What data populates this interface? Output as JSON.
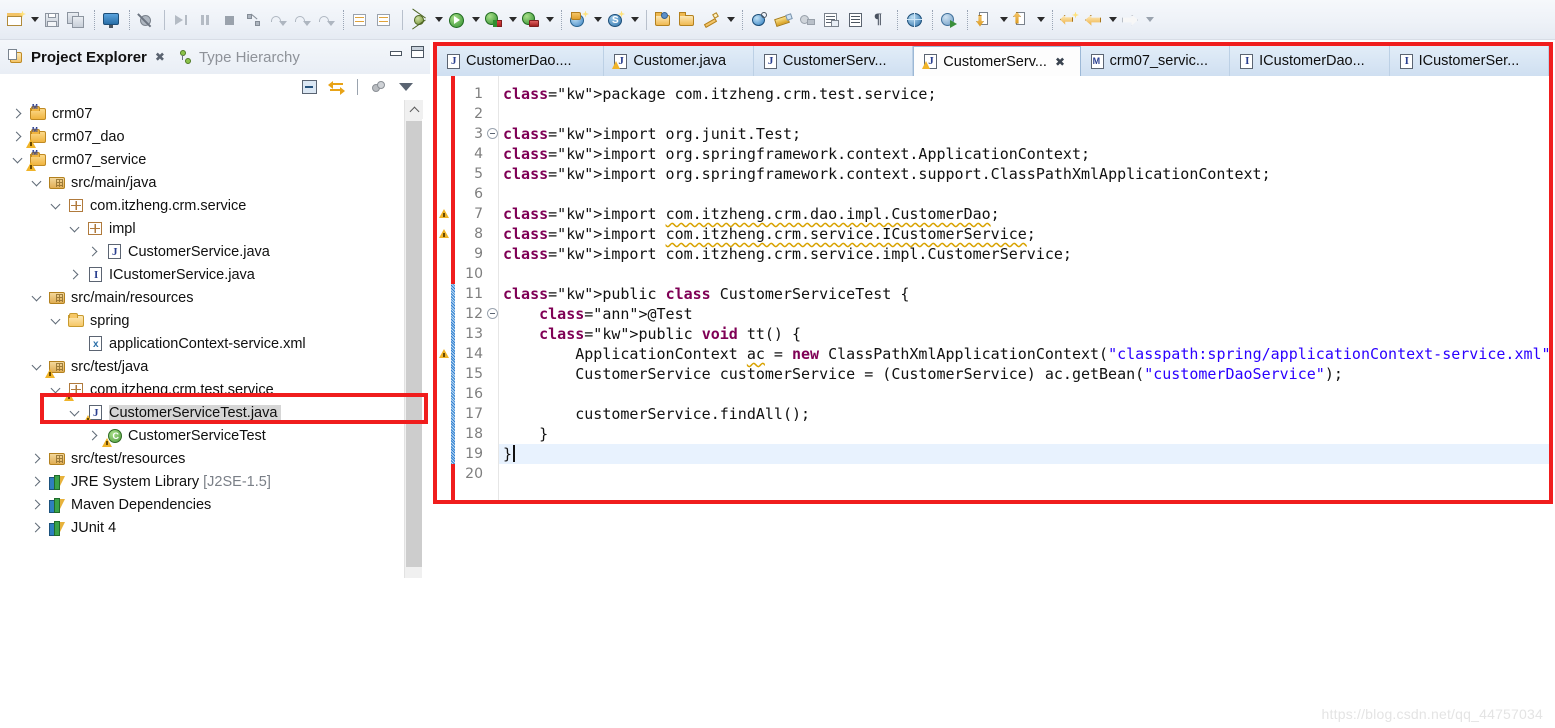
{
  "toolbar": {
    "groups": [
      {
        "name": "file",
        "items": [
          {
            "icon": "new-wizard-icon",
            "dropdown": true
          },
          {
            "icon": "save-icon",
            "dropdown": false
          },
          {
            "icon": "save-all-icon",
            "dropdown": false
          }
        ]
      },
      {
        "name": "console",
        "items": [
          {
            "icon": "open-console-icon",
            "dropdown": false
          }
        ]
      },
      {
        "name": "skip-breakpoints",
        "items": [
          {
            "icon": "skip-all-breakpoints-icon",
            "dropdown": false
          }
        ]
      },
      {
        "name": "debug-controls",
        "items": [
          {
            "icon": "resume-icon",
            "dropdown": false
          },
          {
            "icon": "suspend-icon",
            "dropdown": false
          },
          {
            "icon": "terminate-icon",
            "dropdown": false
          },
          {
            "icon": "disconnect-icon",
            "dropdown": false
          },
          {
            "icon": "step-into-icon",
            "dropdown": false
          },
          {
            "icon": "step-over-icon",
            "dropdown": false
          },
          {
            "icon": "step-return-icon",
            "dropdown": false
          }
        ]
      },
      {
        "name": "coverage",
        "items": [
          {
            "icon": "coverage-session-icon",
            "dropdown": false
          },
          {
            "icon": "coverage-reset-icon",
            "dropdown": false
          }
        ]
      },
      {
        "name": "launch",
        "items": [
          {
            "icon": "debug-bug-icon",
            "dropdown": true
          },
          {
            "icon": "run-icon",
            "dropdown": true
          },
          {
            "icon": "coverage-run-icon",
            "dropdown": true
          },
          {
            "icon": "external-tools-icon",
            "dropdown": true
          }
        ]
      },
      {
        "name": "web",
        "items": [
          {
            "icon": "new-server-icon",
            "dropdown": true
          },
          {
            "icon": "svn-icon",
            "dropdown": true
          }
        ]
      },
      {
        "name": "java",
        "items": [
          {
            "icon": "new-package-icon",
            "dropdown": false
          },
          {
            "icon": "new-class-icon",
            "dropdown": false
          },
          {
            "icon": "new-java-element-icon",
            "dropdown": true
          }
        ]
      },
      {
        "name": "search",
        "items": [
          {
            "icon": "search-icon",
            "dropdown": false
          },
          {
            "icon": "marker-pen-icon",
            "dropdown": false
          },
          {
            "icon": "link-icon",
            "dropdown": false
          },
          {
            "icon": "open-task-icon",
            "dropdown": false
          },
          {
            "icon": "properties-icon",
            "dropdown": false
          },
          {
            "icon": "pilcrow-icon",
            "dropdown": false
          }
        ]
      },
      {
        "name": "browser",
        "items": [
          {
            "icon": "open-browser-icon",
            "dropdown": false
          }
        ]
      },
      {
        "name": "next-annotation",
        "items": [
          {
            "icon": "run-last-tool-icon",
            "dropdown": false
          }
        ]
      },
      {
        "name": "annotations",
        "items": [
          {
            "icon": "next-annotation-icon",
            "dropdown": true
          },
          {
            "icon": "previous-annotation-icon",
            "dropdown": true
          }
        ]
      },
      {
        "name": "navigation",
        "items": [
          {
            "icon": "back-edit-icon",
            "dropdown": false
          },
          {
            "icon": "back-icon",
            "dropdown": true
          },
          {
            "icon": "forward-icon",
            "dropdown": true
          }
        ]
      }
    ]
  },
  "left_panel": {
    "tabs": [
      {
        "label": "Project Explorer",
        "icon": "project-explorer-icon",
        "active": true,
        "closable": true
      },
      {
        "label": "Type Hierarchy",
        "icon": "type-hierarchy-icon",
        "active": false,
        "closable": false
      }
    ],
    "window_controls": [
      {
        "name": "minimize-view-button",
        "icon": "minimize-icon"
      },
      {
        "name": "maximize-view-button",
        "icon": "maximize-icon"
      }
    ],
    "view_tools": [
      {
        "name": "collapse-all-button",
        "icon": "collapse-all-icon"
      },
      {
        "name": "link-with-editor-button",
        "icon": "link-with-editor-icon"
      },
      {
        "name": "focus-on-active-task-button",
        "icon": "focus-active-task-icon"
      },
      {
        "name": "view-menu-button",
        "icon": "view-menu-icon"
      }
    ],
    "tree": [
      {
        "label": "crm07",
        "indent": 0,
        "twisty": "right",
        "icon": "maven-project-icon",
        "warn": false,
        "selected": false
      },
      {
        "label": "crm07_dao",
        "indent": 0,
        "twisty": "right",
        "icon": "maven-project-icon",
        "warn": true,
        "selected": false
      },
      {
        "label": "crm07_service",
        "indent": 0,
        "twisty": "down",
        "icon": "maven-project-icon",
        "warn": true,
        "selected": false
      },
      {
        "label": "src/main/java",
        "indent": 1,
        "twisty": "down",
        "icon": "source-folder-icon",
        "warn": false,
        "selected": false
      },
      {
        "label": "com.itzheng.crm.service",
        "indent": 2,
        "twisty": "down",
        "icon": "package-icon",
        "warn": false,
        "selected": false
      },
      {
        "label": "impl",
        "indent": 3,
        "twisty": "down",
        "icon": "package-icon",
        "warn": false,
        "selected": false
      },
      {
        "label": "CustomerService.java",
        "indent": 4,
        "twisty": "right",
        "icon": "java-file-icon",
        "warn": false,
        "selected": false
      },
      {
        "label": "ICustomerService.java",
        "indent": 3,
        "twisty": "right",
        "icon": "interface-file-icon",
        "warn": false,
        "selected": false
      },
      {
        "label": "src/main/resources",
        "indent": 1,
        "twisty": "down",
        "icon": "source-folder-icon",
        "warn": false,
        "selected": false
      },
      {
        "label": "spring",
        "indent": 2,
        "twisty": "down",
        "icon": "folder-icon",
        "warn": false,
        "selected": false
      },
      {
        "label": "applicationContext-service.xml",
        "indent": 3,
        "twisty": "none",
        "icon": "xml-file-icon",
        "warn": false,
        "selected": false
      },
      {
        "label": "src/test/java",
        "indent": 1,
        "twisty": "down",
        "icon": "source-folder-icon",
        "warn": true,
        "selected": false
      },
      {
        "label": "com.itzheng.crm.test.service",
        "indent": 2,
        "twisty": "down",
        "icon": "package-icon",
        "warn": true,
        "selected": false
      },
      {
        "label": "CustomerServiceTest.java",
        "indent": 3,
        "twisty": "down",
        "icon": "java-file-icon",
        "warn": true,
        "selected": true
      },
      {
        "label": "CustomerServiceTest",
        "indent": 4,
        "twisty": "right",
        "icon": "class-icon",
        "warn": true,
        "selected": false
      },
      {
        "label": "src/test/resources",
        "indent": 1,
        "twisty": "right",
        "icon": "source-folder-icon",
        "warn": false,
        "selected": false
      },
      {
        "label": "JRE System Library",
        "sub": " [J2SE-1.5]",
        "indent": 1,
        "twisty": "right",
        "icon": "library-icon",
        "warn": false,
        "selected": false
      },
      {
        "label": "Maven Dependencies",
        "indent": 1,
        "twisty": "right",
        "icon": "library-icon",
        "warn": false,
        "selected": false
      },
      {
        "label": "JUnit 4",
        "indent": 1,
        "twisty": "right",
        "icon": "library-icon",
        "warn": false,
        "selected": false
      }
    ],
    "scrollbar": {
      "name": "tree-vertical-scrollbar",
      "up_arrow": "chevron-up-icon"
    }
  },
  "editor": {
    "tabs": [
      {
        "label": "CustomerDao....",
        "icon": "java-file-icon",
        "active": false,
        "warn": false,
        "closable": false
      },
      {
        "label": "Customer.java",
        "icon": "java-file-icon",
        "active": false,
        "warn": true,
        "closable": false
      },
      {
        "label": "CustomerServ...",
        "icon": "java-file-icon",
        "active": false,
        "warn": false,
        "closable": false
      },
      {
        "label": "CustomerServ...",
        "icon": "java-file-icon",
        "active": true,
        "warn": true,
        "closable": true
      },
      {
        "label": "crm07_servic...",
        "icon": "maven-pom-icon",
        "active": false,
        "warn": false,
        "closable": false
      },
      {
        "label": "ICustomerDao...",
        "icon": "interface-file-icon",
        "active": false,
        "warn": false,
        "closable": false
      },
      {
        "label": "ICustomerSer...",
        "icon": "interface-file-icon",
        "active": false,
        "warn": false,
        "closable": false
      }
    ],
    "close_glyph": "✖",
    "current_line": 19,
    "lines": [
      {
        "no": 1,
        "text": "package com.itzheng.crm.test.service;"
      },
      {
        "no": 2,
        "text": ""
      },
      {
        "no": 3,
        "text": "import org.junit.Test;",
        "fold": true
      },
      {
        "no": 4,
        "text": "import org.springframework.context.ApplicationContext;"
      },
      {
        "no": 5,
        "text": "import org.springframework.context.support.ClassPathXmlApplicationContext;"
      },
      {
        "no": 6,
        "text": ""
      },
      {
        "no": 7,
        "text": "import com.itzheng.crm.dao.impl.CustomerDao;",
        "warn": true
      },
      {
        "no": 8,
        "text": "import com.itzheng.crm.service.ICustomerService;",
        "warn": true
      },
      {
        "no": 9,
        "text": "import com.itzheng.crm.service.impl.CustomerService;"
      },
      {
        "no": 10,
        "text": ""
      },
      {
        "no": 11,
        "text": "public class CustomerServiceTest {"
      },
      {
        "no": 12,
        "text": "    @Test",
        "fold": true
      },
      {
        "no": 13,
        "text": "    public void tt() {"
      },
      {
        "no": 14,
        "text": "        ApplicationContext ac = new ClassPathXmlApplicationContext(\"classpath:spring/applicationContext-service.xml\");",
        "warn": true
      },
      {
        "no": 15,
        "text": "        CustomerService customerService = (CustomerService) ac.getBean(\"customerDaoService\");"
      },
      {
        "no": 16,
        "text": ""
      },
      {
        "no": 17,
        "text": "        customerService.findAll();"
      },
      {
        "no": 18,
        "text": "    }"
      },
      {
        "no": 19,
        "text": "}"
      },
      {
        "no": 20,
        "text": ""
      }
    ]
  },
  "watermark": {
    "text": "https://blog.csdn.net/qq_44757034"
  },
  "colors": {
    "highlight_red": "#f01d1d",
    "keyword": "#7f0055",
    "string": "#2a00ff",
    "annotation": "#646464",
    "field": "#0000c0",
    "current_line_bg": "#e8f2fe",
    "selection_bg": "#d6d6d6",
    "tab_active_bg": "#fdfdfd",
    "tab_inactive_bg": "#cfdff1"
  }
}
